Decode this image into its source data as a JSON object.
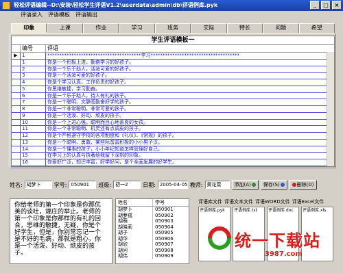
{
  "window": {
    "title": "轻松评语编辑--D:\\安装\\轻松学生评语V1.2\\userdata\\admin\\db\\评语例库.pyk",
    "minimize": "_",
    "maximize": "□",
    "close": "×"
  },
  "menu": [
    "评语录入",
    "评语模板",
    "评语输出"
  ],
  "tabs": [
    "印象",
    "上课",
    "作业",
    "学习",
    "班务",
    "交际",
    "特长",
    "问题",
    "希望"
  ],
  "active_tab": 0,
  "grid": {
    "title": "学生评语模板一",
    "col_no": "编号",
    "col_text": "评语",
    "rows": [
      {
        "no": "1",
        "text": "***************************************学习*************************************",
        "current": true
      },
      {
        "no": "1",
        "text": "你是一个积极上进，勤奋学习的好孩子。"
      },
      {
        "no": "2",
        "text": "你是一个乐于助人，活泼可爱的好孩子。"
      },
      {
        "no": "3",
        "text": "你是一个活泼可爱的好孩子。"
      },
      {
        "no": "4",
        "text": "你是个学习认真，工作负责的好孩子。"
      },
      {
        "no": "5",
        "text": "你思维敏捷，学习勤奋。"
      },
      {
        "no": "6",
        "text": "你是一个乐于助人，待人有礼的孩子。"
      },
      {
        "no": "7",
        "text": "你是一个聪明、文静而勤奋好学的孩子。"
      },
      {
        "no": "8",
        "text": "你是一个非常聪明，非常可爱的孩子。"
      },
      {
        "no": "9",
        "text": "你是一个活泼、好动、顽皮的孩子。"
      },
      {
        "no": "10",
        "text": "你是一个上进心强，聪明而且心地善良的女孩。"
      },
      {
        "no": "11",
        "text": "你是一个非常聪明、机灵还有点调皮的孩子。"
      },
      {
        "no": "12",
        "text": "你是个严格遵守学校的各项制度和《礼仪》、《常规》的孩子。"
      },
      {
        "no": "13",
        "text": "你是一个聪明、勇敢、某些际蛮富积极的小小男子汉。"
      },
      {
        "no": "14",
        "text": "你是一个懂事的孩子，小小年纪知道怎样管理好自己。"
      },
      {
        "no": "15",
        "text": "在学习上的认真与执著给我留下深刻的印象。"
      },
      {
        "no": "16",
        "text": "你爱好广泛，知识丰富，好学好问，是个全面发展的好学生。"
      }
    ]
  },
  "form": {
    "name_label": "姓名:",
    "name_value": "胡梦卜",
    "id_label": "学号:",
    "id_value": "050901",
    "class_label": "班级:",
    "class_value": "初一2",
    "date_label": "日期:",
    "date_value": "2005-04-05",
    "teacher_label": "教师:",
    "teacher_value": "黄花菜",
    "add_label": "添加(A)",
    "save_label": "保存(S)",
    "delete_label": "删除(D)"
  },
  "comment_text": "你给老师的第一个印象是你那优美的谈吐，端庄的举止。老师的第一个印象是你那样的有礼的回合，思维的敏捷，无疑，你是个好学生，但是，你别常忘记一个是不好的毛病，那就是粗心，你是一个活泼、好动、顽皮的孩子。",
  "names": {
    "col1": "姓名",
    "col2": "学号",
    "rows": [
      {
        "name": "胡梦卜",
        "id": "050901"
      },
      {
        "name": "胡萝孤",
        "id": "050902"
      },
      {
        "name": "胡萌",
        "id": "050903"
      },
      {
        "name": "胡晓莉",
        "id": "050904"
      },
      {
        "name": "胡子",
        "id": "050905"
      },
      {
        "name": "胡华",
        "id": "050906"
      },
      {
        "name": "胡欣",
        "id": "050907"
      },
      {
        "name": "胡问",
        "id": "050908"
      },
      {
        "name": "胡伟",
        "id": "050909"
      }
    ]
  },
  "files": {
    "labels": [
      "评语库文件",
      "评语文本文件",
      "评语WORD文件",
      "评语Excel文件"
    ],
    "boxes": [
      "评语例库.pyk",
      "评语例库.txt",
      "评语例库.doc",
      "评语例库.xls"
    ]
  },
  "watermark": {
    "main": "统一下载站",
    "sub": "3987.com"
  },
  "colors": {
    "title_bar": "#1a3fa8",
    "row_text": "#1c1cc8",
    "watermark": "#d42020"
  }
}
